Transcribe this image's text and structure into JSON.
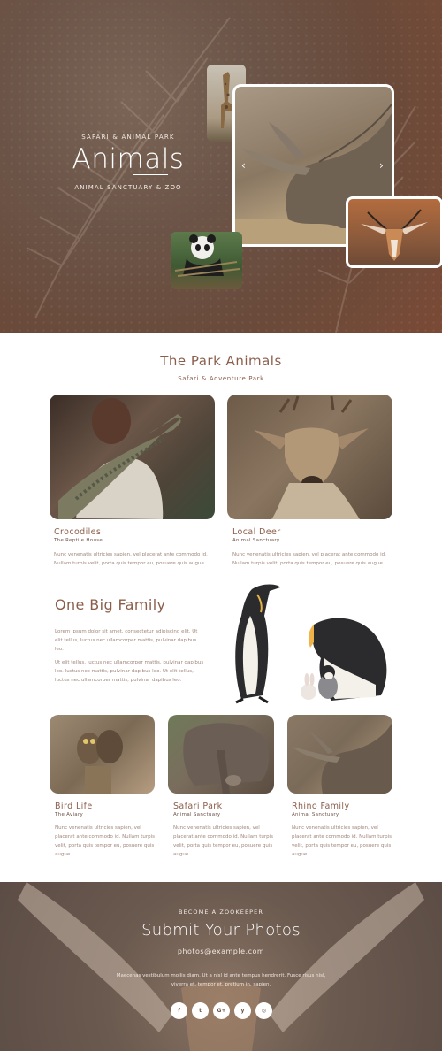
{
  "hero": {
    "kicker": "SAFARI & ANIMAL PARK",
    "title": "Animals",
    "subtitle": "ANIMAL SANCTUARY & ZOO",
    "prev_arrow": "‹",
    "next_arrow": "›"
  },
  "park": {
    "title": "The Park Animals",
    "subtitle": "Safari & Adventure Park",
    "featured": [
      {
        "title": "Crocodiles",
        "tag": "The Reptile House",
        "text_1": "Nunc venenatis ultricies sapien, vel placerat ante commodo id.",
        "text_2": "Nullam turpis velit, porta quis tempor eu, posuere quis augue."
      },
      {
        "title": "Local Deer",
        "tag": "Animal Sanctuary",
        "text_1": "Nunc venenatis ultricies sapien, vel placerat ante commodo id.",
        "text_2": "Nullam turpis velit, porta quis tempor eu, posuere quis augue."
      }
    ]
  },
  "family": {
    "title": "One Big Family",
    "p1_1": "Lorem ipsum dolor sit amet, consectetur adipiscing elit. Ut",
    "p1_2": "elit tellus, luctus nec ullamcorper mattis, pulvinar dapibus",
    "p1_3": "leo.",
    "p2_1": "Ut elit tellus, luctus nec ullamcorper mattis, pulvinar dapibus",
    "p2_2": "leo. luctus nec mattis, pulvinar dapibus leo. Ut elit tellus,",
    "p2_3": "luctus nec ullamcorper mattis, pulvinar dapibus leo."
  },
  "more": [
    {
      "title": "Bird Life",
      "tag": "The Aviary",
      "l1": "Nunc venenatis ultricies sapien, vel",
      "l2": "placerat ante commodo id. Nullam turpis",
      "l3": "velit, porta quis tempor eu, posuere quis",
      "l4": "augue."
    },
    {
      "title": "Safari Park",
      "tag": "Animal Sanctuary",
      "l1": "Nunc venenatis ultricies sapien, vel",
      "l2": "placerat ante commodo id. Nullam turpis",
      "l3": "velit, porta quis tempor eu, posuere quis",
      "l4": "augue."
    },
    {
      "title": "Rhino Family",
      "tag": "Animal Sanctuary",
      "l1": "Nunc venenatis ultricies sapien, vel",
      "l2": "placerat ante commodo id. Nullam turpis",
      "l3": "velit, porta quis tempor eu, posuere quis",
      "l4": "augue."
    }
  ],
  "footer": {
    "kicker": "BECOME A ZOOKEEPER",
    "title": "Submit Your Photos",
    "email": "photos@example.com",
    "text_1": "Maecenas vestibulum mollis diam. Ut a nisl id ante tempus hendrerit. Fusce risus nisl,",
    "text_2": "viverra et, tempor et, pretium in, sapien.",
    "social": [
      {
        "icon": "facebook-icon",
        "glyph": "f"
      },
      {
        "icon": "twitter-icon",
        "glyph": "t"
      },
      {
        "icon": "google-plus-icon",
        "glyph": "G+"
      },
      {
        "icon": "yelp-icon",
        "glyph": "y"
      },
      {
        "icon": "instagram-icon",
        "glyph": "◎"
      }
    ]
  },
  "colors": {
    "accent": "#8b5e4a",
    "body_text": "#a0857b"
  }
}
